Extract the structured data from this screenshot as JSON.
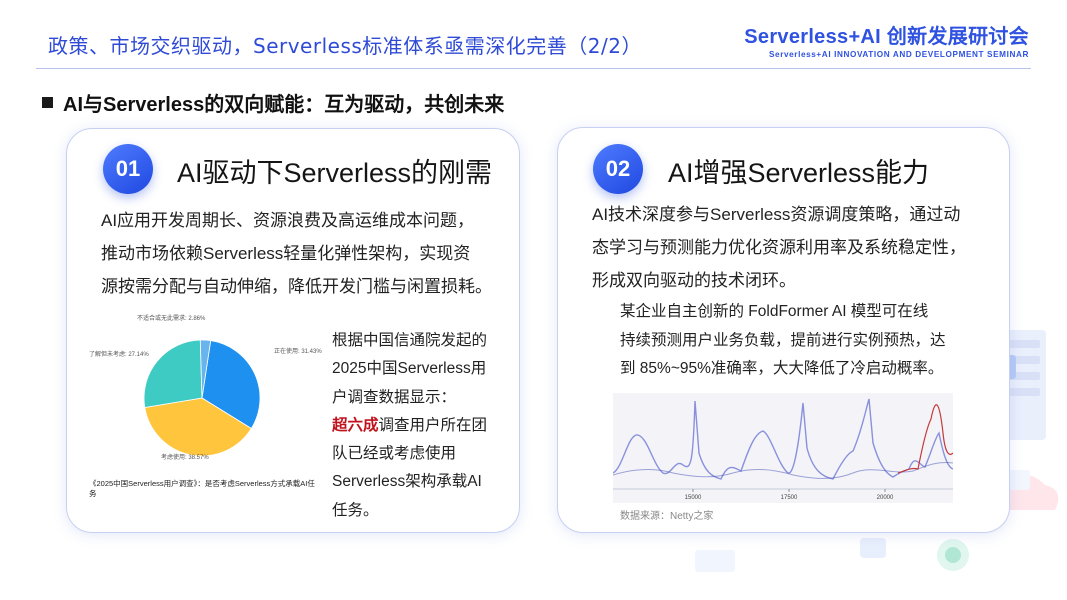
{
  "header": {
    "title": "政策、市场交织驱动，Serverless标准体系亟需深化完善（2/2）",
    "brand_name": "Serverless+AI 创新发展研讨会",
    "brand_sub": "Serverless+AI INNOVATION AND DEVELOPMENT SEMINAR"
  },
  "section": {
    "title": "AI与Serverless的双向赋能：互为驱动，共创未来"
  },
  "left_card": {
    "number": "01",
    "title": "AI驱动下Serverless的刚需",
    "desc_lines": [
      "AI应用开发周期长、资源浪费及高运维成本问题，",
      "推动市场依赖Serverless轻量化弹性架构，实现资",
      "源按需分配与自动伸缩，降低开发门槛与闲置损耗。"
    ],
    "pie_caption": "《2025中国Serverless用户调查》：是否考虑Serverless方式承载AI任务",
    "pie": {
      "slices": [
        {
          "label": "正在使用",
          "value": 31.43,
          "display": "正在使用: 31.43%",
          "color": "#1e90f0"
        },
        {
          "label": "考虑使用",
          "value": 38.57,
          "display": "考虑使用: 38.57%",
          "color": "#ffc53d"
        },
        {
          "label": "了解但未考虑",
          "value": 27.14,
          "display": "了解但未考虑: 27.14%",
          "color": "#3ecbc4"
        },
        {
          "label": "不适合或无此需求",
          "value": 2.86,
          "display": "不适合或无此需求: 2.86%",
          "color": "#6ab4ee"
        }
      ]
    },
    "survey_lines": [
      "根据中国信通院发起的",
      "2025中国Serverless用",
      "户调查数据显示："
    ],
    "survey_highlight": "超六成",
    "survey_rest_first": "调查用户所在团",
    "survey_rest_lines": [
      "队已经或考虑使用",
      "Serverless架构承载AI",
      "任务。"
    ]
  },
  "right_card": {
    "number": "02",
    "title": "AI增强Serverless能力",
    "desc_lines": [
      "AI技术深度参与Serverless资源调度策略，通过动",
      "态学习与预测能力优化资源利用率及系统稳定性，",
      "形成双向驱动的技术闭环。"
    ],
    "example_lines": [
      "某企业自主创新的 FoldFormer AI 模型可在线",
      "持续预测用户业务负载，提前进行实例预热，达",
      "到 85%~95%准确率，大大降低了冷启动概率。"
    ],
    "chart_ticks": [
      "15000",
      "17500",
      "20000"
    ],
    "chart_source": "数据来源：Netty之家"
  },
  "colors": {
    "accent": "#2f52e0",
    "highlight": "#c0121c"
  }
}
